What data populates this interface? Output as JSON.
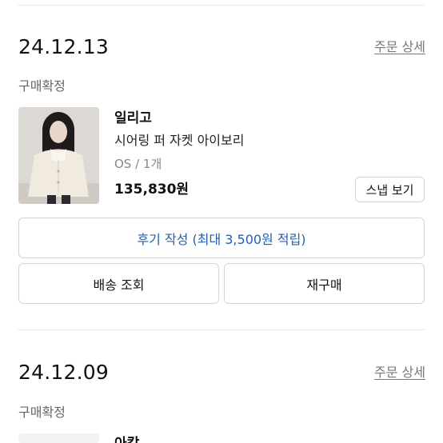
{
  "orders": [
    {
      "date": "24.12.13",
      "detail_link": "주문 상세",
      "status": "구매확정",
      "item": {
        "brand": "일리고",
        "name": "시어링 퍼 자켓 아이보리",
        "option": "OS / 1개",
        "price": "135,830원",
        "snap_button": "스냅 보기"
      },
      "review_button": "후기 작성 (최대 3,500원 적립)",
      "delivery_button": "배송 조회",
      "rebuy_button": "재구매"
    },
    {
      "date": "24.12.09",
      "detail_link": "주문 상세",
      "status": "구매확정",
      "item": {
        "brand": "아캄"
      }
    }
  ],
  "colors": {
    "accent_link": "#1f5fbf",
    "muted_text": "#777777",
    "border": "#d4d4d4"
  }
}
